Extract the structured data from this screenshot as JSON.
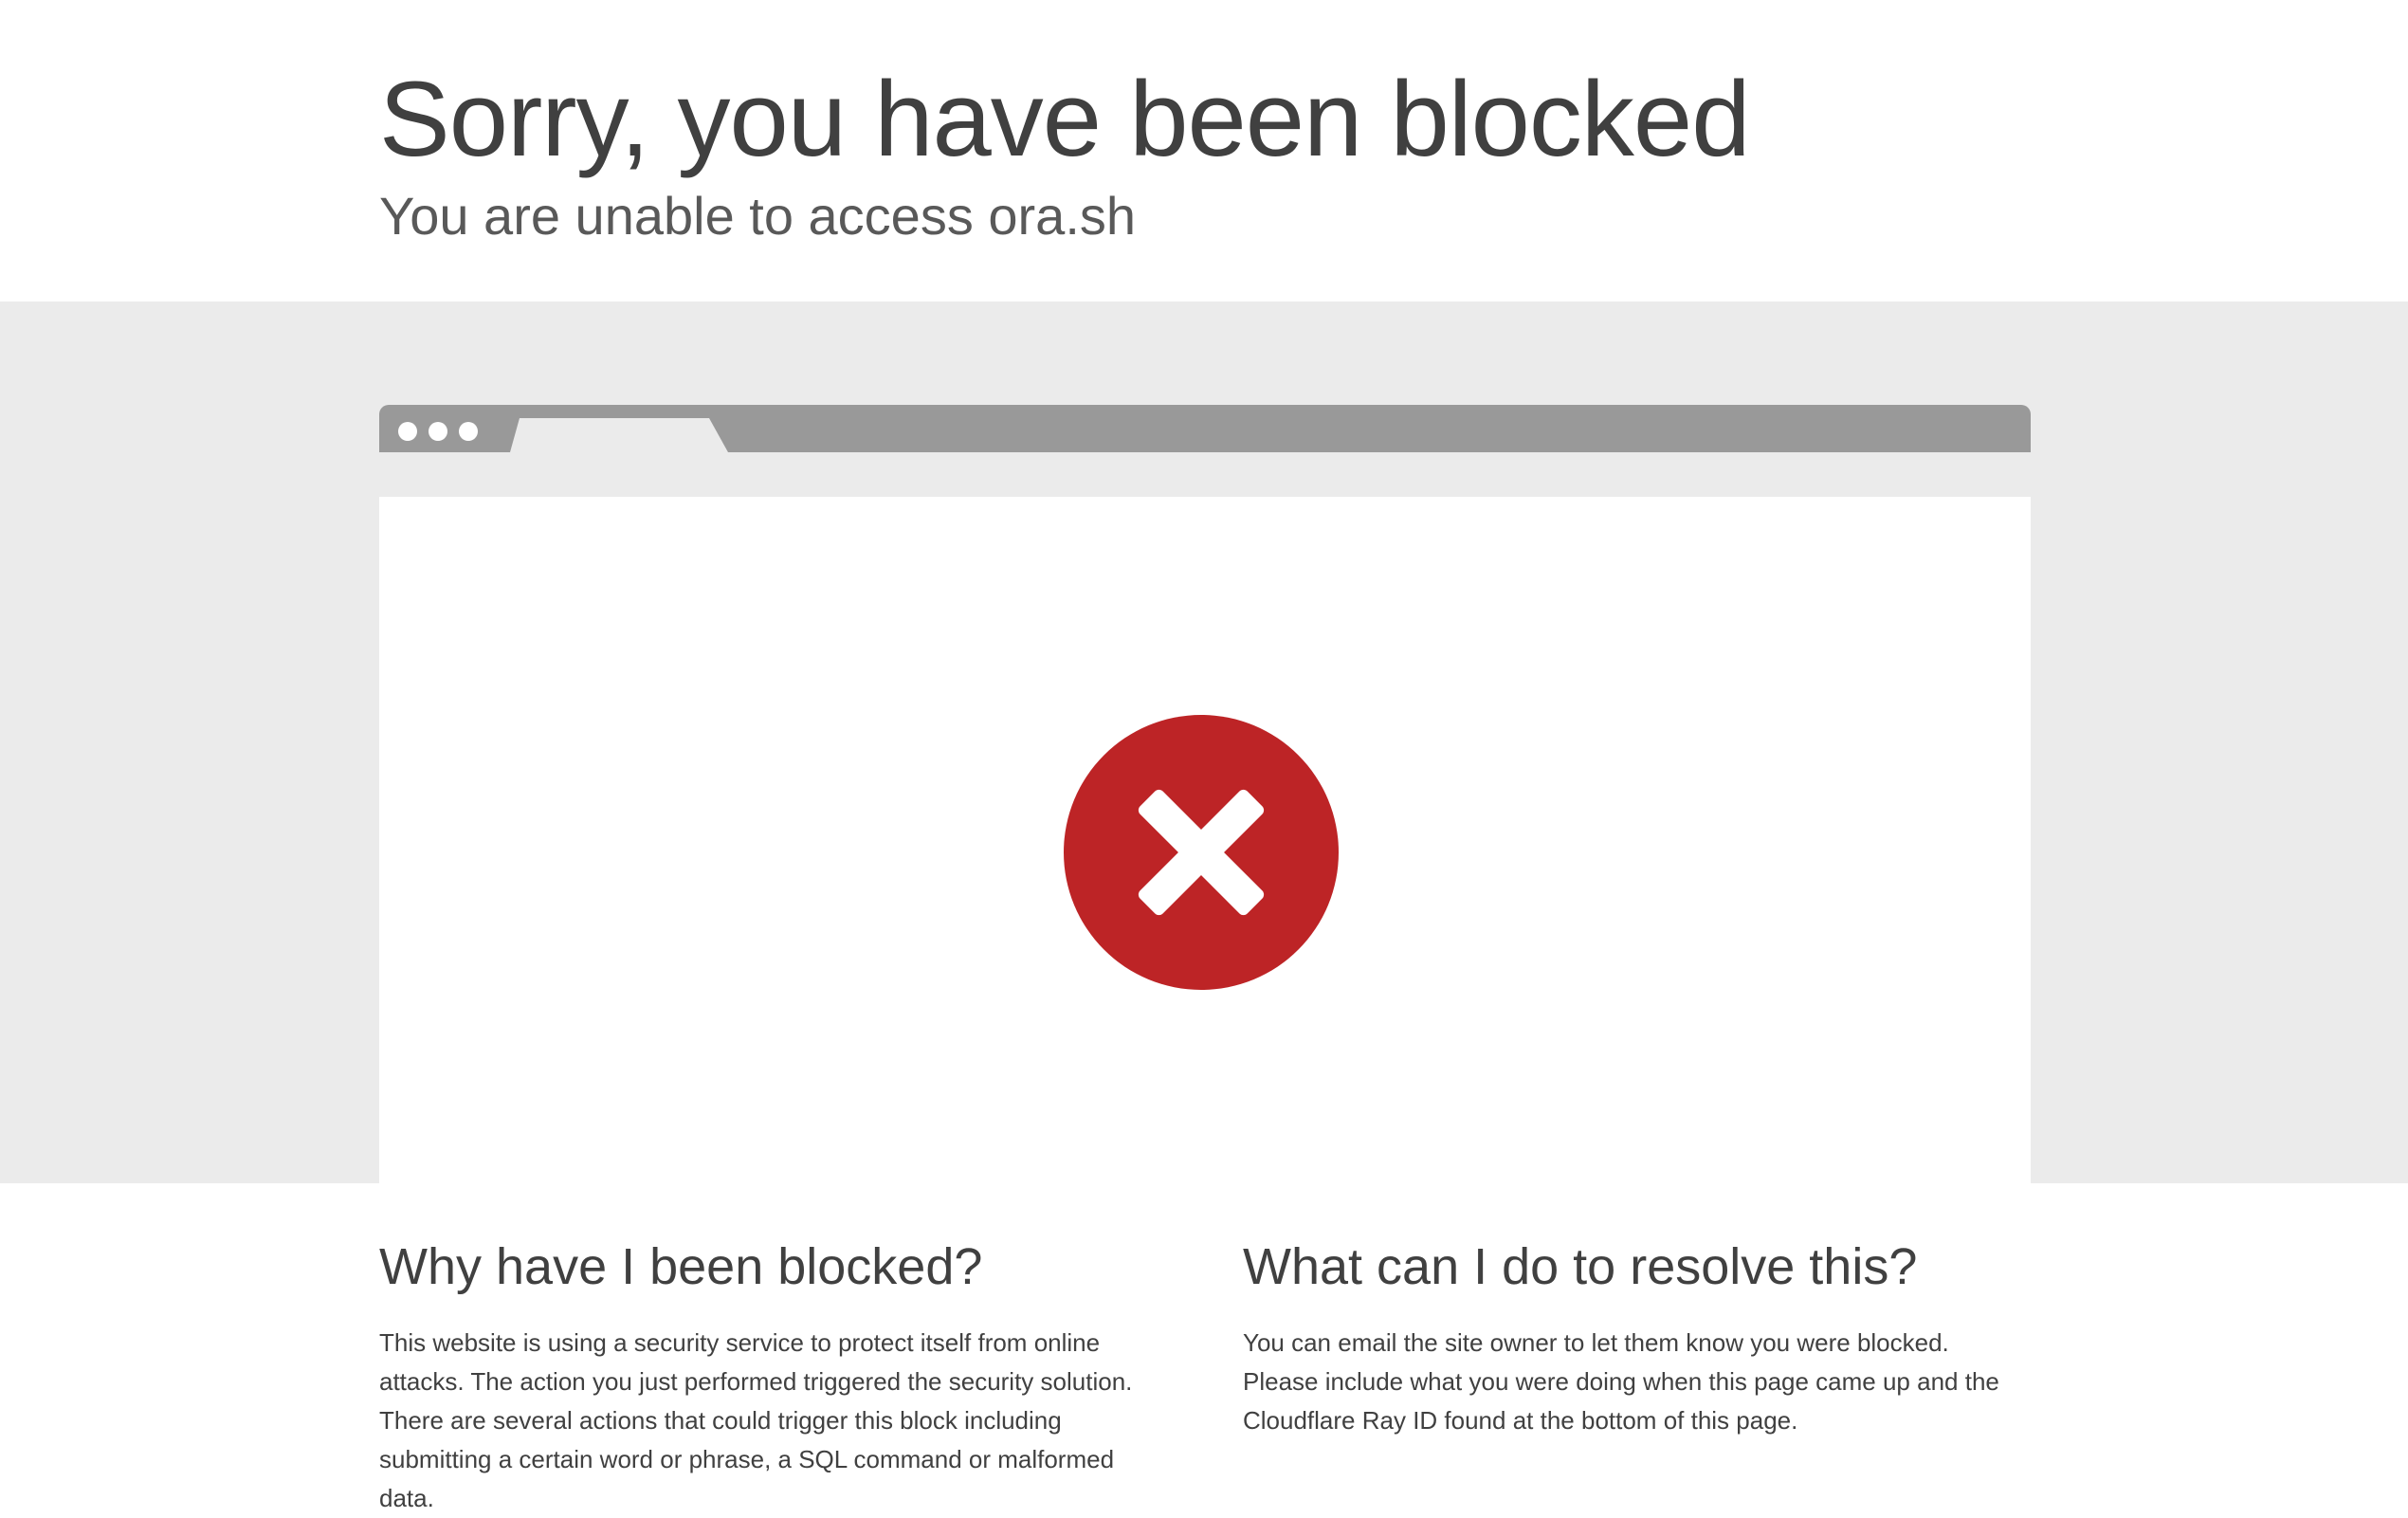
{
  "header": {
    "title": "Sorry, you have been blocked",
    "subtitle": "You are unable to access ora.sh"
  },
  "illustration": {
    "icon": "error-x-icon",
    "icon_color": "#bd2426",
    "bar_color": "#999999",
    "background_color": "#ebebeb"
  },
  "why": {
    "heading": "Why have I been blocked?",
    "body": "This website is using a security service to protect itself from online attacks. The action you just performed triggered the security solution. There are several actions that could trigger this block including submitting a certain word or phrase, a SQL command or malformed data."
  },
  "resolve": {
    "heading": "What can I do to resolve this?",
    "body": "You can email the site owner to let them know you were blocked. Please include what you were doing when this page came up and the Cloudflare Ray ID found at the bottom of this page."
  }
}
